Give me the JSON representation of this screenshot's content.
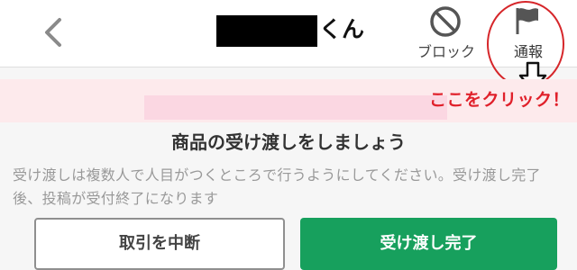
{
  "header": {
    "back_icon": "chevron-left-icon",
    "title_suffix": "くん",
    "block_label": "ブロック",
    "block_icon": "prohibit-icon",
    "report_label": "通報",
    "report_icon": "flag-icon"
  },
  "annotation": {
    "text": "ここをクリック！",
    "arrow_icon": "arrow-down-icon",
    "color": "#e0202a"
  },
  "content": {
    "title": "商品の受け渡しをしましょう",
    "description": "受け渡しは複数人で人目がつくところで行うようにしてください。受け渡し完了後、投稿が受付終了になります"
  },
  "actions": {
    "cancel_label": "取引を中断",
    "complete_label": "受け渡し完了",
    "complete_color": "#17a05d"
  }
}
